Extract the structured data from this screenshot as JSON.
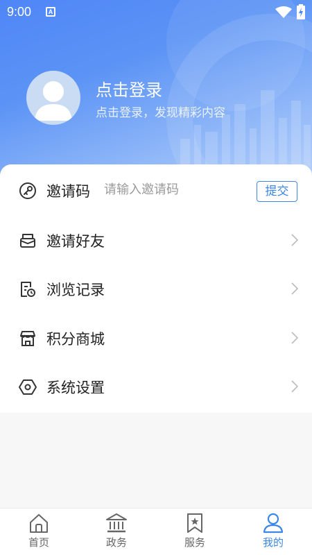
{
  "status_bar": {
    "time": "9:00",
    "notification_icon": "A"
  },
  "profile": {
    "title": "点击登录",
    "subtitle": "点击登录，发现精彩内容"
  },
  "invite": {
    "label": "邀请码",
    "placeholder": "请输入邀请码",
    "submit_label": "提交"
  },
  "menu": {
    "items": [
      {
        "label": "邀请好友",
        "icon": "envelope-icon"
      },
      {
        "label": "浏览记录",
        "icon": "history-icon"
      },
      {
        "label": "积分商城",
        "icon": "store-icon"
      },
      {
        "label": "系统设置",
        "icon": "settings-hexagon-icon"
      }
    ]
  },
  "tabs": [
    {
      "label": "首页",
      "icon": "home-icon",
      "active": false
    },
    {
      "label": "政务",
      "icon": "government-icon",
      "active": false
    },
    {
      "label": "服务",
      "icon": "bookmark-star-icon",
      "active": false
    },
    {
      "label": "我的",
      "icon": "user-icon",
      "active": true
    }
  ],
  "colors": {
    "accent": "#3b86e6",
    "header_start": "#4f86f7",
    "header_end": "#b9d2fb"
  }
}
